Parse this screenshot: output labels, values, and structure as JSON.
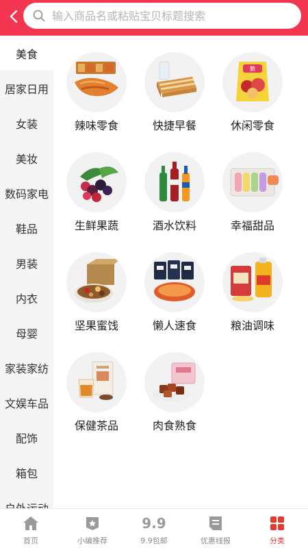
{
  "search": {
    "placeholder": "输入商品名或粘贴宝贝标题搜索"
  },
  "sidebar": {
    "items": [
      {
        "label": "美食",
        "active": true
      },
      {
        "label": "居家日用"
      },
      {
        "label": "女装"
      },
      {
        "label": "美妆"
      },
      {
        "label": "数码家电"
      },
      {
        "label": "鞋品"
      },
      {
        "label": "男装"
      },
      {
        "label": "内衣"
      },
      {
        "label": "母婴"
      },
      {
        "label": "家装家纺"
      },
      {
        "label": "文娱车品"
      },
      {
        "label": "配饰"
      },
      {
        "label": "箱包"
      },
      {
        "label": "户外运动"
      }
    ]
  },
  "categories": [
    {
      "label": "辣味零食",
      "icon": "spicy-snack-icon"
    },
    {
      "label": "快捷早餐",
      "icon": "bread-icon"
    },
    {
      "label": "休闲零食",
      "icon": "chips-icon"
    },
    {
      "label": "生鲜果蔬",
      "icon": "berries-icon"
    },
    {
      "label": "酒水饮料",
      "icon": "bottles-icon"
    },
    {
      "label": "幸福甜品",
      "icon": "macaron-icon"
    },
    {
      "label": "坚果蜜饯",
      "icon": "nuts-icon"
    },
    {
      "label": "懒人速食",
      "icon": "instant-noodle-icon"
    },
    {
      "label": "粮油调味",
      "icon": "rice-oil-icon"
    },
    {
      "label": "保健茶品",
      "icon": "tea-icon"
    },
    {
      "label": "肉食熟食",
      "icon": "meat-icon"
    }
  ],
  "tabbar": {
    "tabs": [
      {
        "label": "首页",
        "icon": "home-icon"
      },
      {
        "label": "小编推荐",
        "icon": "recommend-icon"
      },
      {
        "label": "9.9包邮",
        "icon": "price-99-icon",
        "icon_text": "9.9"
      },
      {
        "label": "优惠线报",
        "icon": "deal-news-icon"
      },
      {
        "label": "分类",
        "icon": "category-grid-icon",
        "active": true
      }
    ]
  },
  "colors": {
    "brand": "#f2364f",
    "active_tab": "#e53a2f",
    "sidebar_bg": "#f5f5f5"
  }
}
